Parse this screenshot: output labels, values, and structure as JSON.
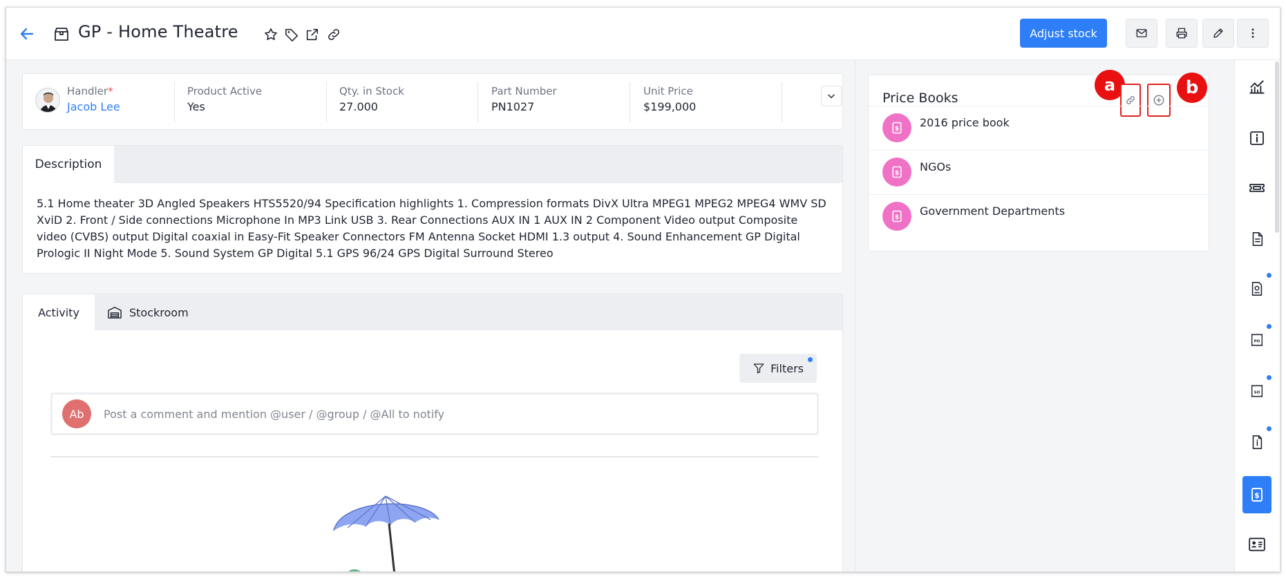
{
  "header": {
    "title": "GP - Home Theatre",
    "adjust_stock_label": "Adjust stock",
    "icons": [
      "back-arrow-icon",
      "product-box-icon",
      "star-icon",
      "tag-icon",
      "external-link-icon",
      "link-icon",
      "mail-icon",
      "print-icon",
      "edit-icon",
      "more-vertical-icon"
    ]
  },
  "summary": {
    "fields": [
      {
        "label": "Handler",
        "value": "Jacob Lee",
        "required_mark": "*"
      },
      {
        "label": "Product Active",
        "value": "Yes"
      },
      {
        "label": "Qty. in Stock",
        "value": "27.000"
      },
      {
        "label": "Part Number",
        "value": "PN1027"
      },
      {
        "label": "Unit Price",
        "value": "$199,000"
      }
    ]
  },
  "description": {
    "tab_label": "Description",
    "text": "5.1 Home theater 3D Angled Speakers HTS5520/94 Specification highlights 1. Compression formats DivX Ultra MPEG1 MPEG2 MPEG4 WMV SD XviD 2. Front / Side connections Microphone In MP3 Link USB 3. Rear Connections AUX IN 1 AUX IN 2 Component Video output Composite video (CVBS) output Digital coaxial in Easy-Fit Speaker Connectors FM Antenna Socket HDMI 1.3 output 4. Sound Enhancement GP Digital Prologic II Night Mode 5. Sound System GP Digital 5.1 GPS 96/24 GPS Digital Surround Stereo"
  },
  "activity": {
    "tabs": [
      {
        "label": "Activity",
        "active": true
      },
      {
        "label": "Stockroom",
        "active": false
      }
    ],
    "filters_label": "Filters",
    "comment_avatar": "Ab",
    "comment_placeholder": "Post a comment and mention @user / @group / @All to notify"
  },
  "price_books": {
    "title": "Price Books",
    "markers": [
      "a",
      "b"
    ],
    "items": [
      {
        "name": "2016 price book"
      },
      {
        "name": "NGOs"
      },
      {
        "name": "Government Departments"
      }
    ]
  },
  "rail": {
    "items": [
      {
        "icon": "analytics-chart-icon",
        "badge": false,
        "active": false
      },
      {
        "icon": "info-icon",
        "badge": false,
        "active": false
      },
      {
        "icon": "ticket-icon",
        "badge": false,
        "active": false
      },
      {
        "icon": "document-icon",
        "badge": false,
        "active": false
      },
      {
        "icon": "quote-document-icon",
        "badge": true,
        "active": false
      },
      {
        "icon": "purchase-order-icon",
        "badge": true,
        "active": false
      },
      {
        "icon": "sales-order-icon",
        "badge": true,
        "active": false
      },
      {
        "icon": "invoice-icon",
        "badge": true,
        "active": false
      },
      {
        "icon": "price-book-icon",
        "badge": false,
        "active": true
      },
      {
        "icon": "contact-card-icon",
        "badge": false,
        "active": false
      }
    ]
  },
  "colors": {
    "accent": "#2d7ef7",
    "marker_red": "#e81010",
    "price_book_pink": "#f072c6",
    "comment_avatar": "#e07070"
  }
}
